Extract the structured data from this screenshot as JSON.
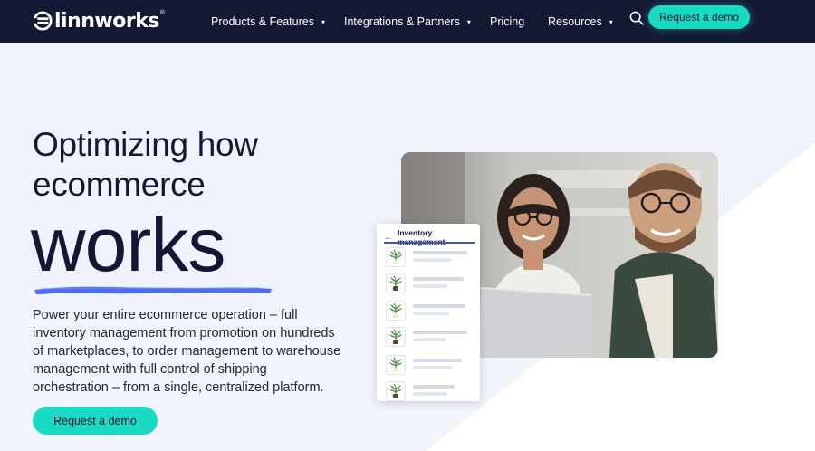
{
  "nav": {
    "brand": "linnworks",
    "brand_mark": "®",
    "items": [
      {
        "label": "Products & Features",
        "has_dropdown": true
      },
      {
        "label": "Integrations & Partners",
        "has_dropdown": true
      },
      {
        "label": "Pricing",
        "has_dropdown": false
      },
      {
        "label": "Resources",
        "has_dropdown": true
      }
    ],
    "dropdown_caret": "▾",
    "search_icon": "search-icon",
    "cta_label": "Request a demo"
  },
  "hero": {
    "title_line1": "Optimizing how",
    "title_line2": "ecommerce",
    "title_emphasis": "works",
    "description": "Power your entire ecommerce operation – full inventory management from promotion on hundreds of marketplaces, to order management to warehouse management with full control of shipping orchestration – from a single, centralized platform.",
    "cta_label": "Request a demo"
  },
  "inventory_card": {
    "title": "Inventory management",
    "back_icon": "arrow-left-icon",
    "rows": [
      {
        "icon": "plant-icon"
      },
      {
        "icon": "plant-icon"
      },
      {
        "icon": "plant-icon"
      },
      {
        "icon": "plant-icon"
      },
      {
        "icon": "plant-icon"
      },
      {
        "icon": "plant-icon"
      }
    ]
  },
  "colors": {
    "nav_bg": "#141833",
    "accent": "#19dbc3",
    "text_dark": "#131733",
    "underline": "#4d6ef0",
    "card_accent": "#3b53c8"
  }
}
